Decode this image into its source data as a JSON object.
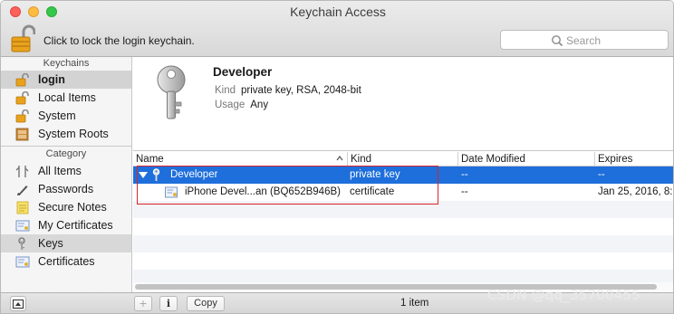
{
  "window": {
    "title": "Keychain Access"
  },
  "toolbar": {
    "lock_text": "Click to lock the login keychain.",
    "search_placeholder": "Search"
  },
  "sidebar": {
    "keychains_header": "Keychains",
    "keychains": [
      {
        "label": "login",
        "icon": "lock-open-icon",
        "selected": true
      },
      {
        "label": "Local Items",
        "icon": "lock-open-icon"
      },
      {
        "label": "System",
        "icon": "lock-open-icon"
      },
      {
        "label": "System Roots",
        "icon": "cabinet-icon"
      }
    ],
    "category_header": "Category",
    "categories": [
      {
        "label": "All Items",
        "icon": "all-items-icon"
      },
      {
        "label": "Passwords",
        "icon": "pen-icon"
      },
      {
        "label": "Secure Notes",
        "icon": "note-icon"
      },
      {
        "label": "My Certificates",
        "icon": "certificate-icon"
      },
      {
        "label": "Keys",
        "icon": "key-icon",
        "selected": true
      },
      {
        "label": "Certificates",
        "icon": "certificate-icon"
      }
    ]
  },
  "detail": {
    "name": "Developer",
    "kind_label": "Kind",
    "kind_value": "private key, RSA, 2048-bit",
    "usage_label": "Usage",
    "usage_value": "Any"
  },
  "table": {
    "columns": [
      "Name",
      "Kind",
      "Date Modified",
      "Expires"
    ],
    "rows": [
      {
        "name": "Developer",
        "kind": "private key",
        "date_modified": "--",
        "expires": "--",
        "selected": true,
        "expanded": true
      },
      {
        "name": "iPhone Devel...an (BQ652B946B)",
        "kind": "certificate",
        "date_modified": "--",
        "expires": "Jan 25, 2016, 8:"
      }
    ]
  },
  "bottombar": {
    "add_label": "+",
    "info_label": "i",
    "copy_label": "Copy",
    "status": "1 item"
  },
  "watermark": "CSDN @qq_35700455",
  "colors": {
    "selection": "#1e6fdb",
    "annotation": "#d9262b"
  }
}
